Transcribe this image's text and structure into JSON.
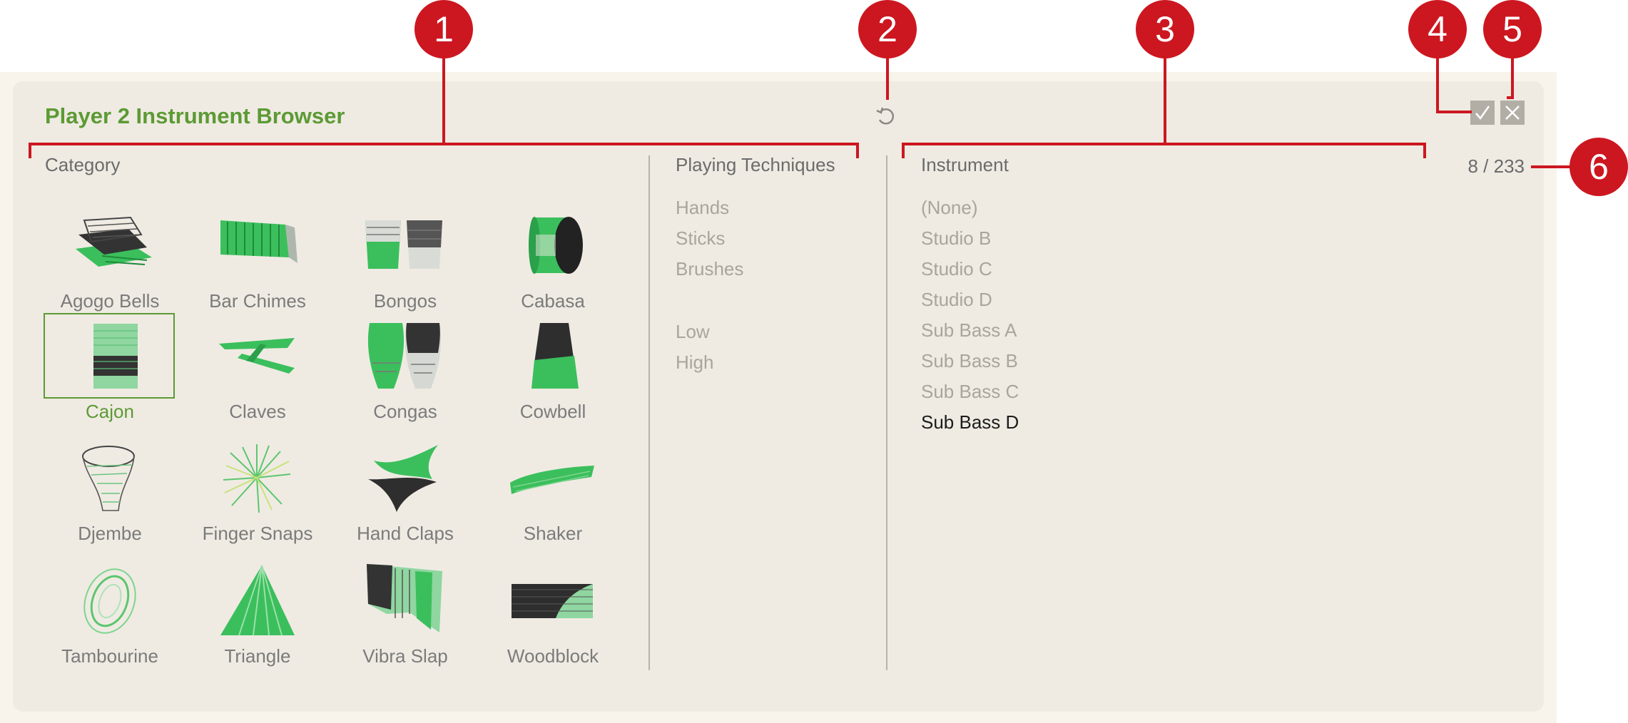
{
  "browser": {
    "title": "Player 2 Instrument Browser",
    "counter": "8 / 233",
    "category_label": "Category",
    "techniques_label": "Playing Techniques",
    "instrument_label": "Instrument"
  },
  "categories": [
    {
      "label": "Agogo Bells",
      "icon": "agogo-bells-icon"
    },
    {
      "label": "Bar Chimes",
      "icon": "bar-chimes-icon"
    },
    {
      "label": "Bongos",
      "icon": "bongos-icon"
    },
    {
      "label": "Cabasa",
      "icon": "cabasa-icon"
    },
    {
      "label": "Cajon",
      "icon": "cajon-icon",
      "selected": true
    },
    {
      "label": "Claves",
      "icon": "claves-icon"
    },
    {
      "label": "Congas",
      "icon": "congas-icon"
    },
    {
      "label": "Cowbell",
      "icon": "cowbell-icon"
    },
    {
      "label": "Djembe",
      "icon": "djembe-icon"
    },
    {
      "label": "Finger Snaps",
      "icon": "finger-snaps-icon"
    },
    {
      "label": "Hand Claps",
      "icon": "hand-claps-icon"
    },
    {
      "label": "Shaker",
      "icon": "shaker-icon"
    },
    {
      "label": "Tambourine",
      "icon": "tambourine-icon"
    },
    {
      "label": "Triangle",
      "icon": "triangle-icon"
    },
    {
      "label": "Vibra Slap",
      "icon": "vibra-slap-icon"
    },
    {
      "label": "Woodblock",
      "icon": "woodblock-icon"
    }
  ],
  "techniques": [
    "Hands",
    "Sticks",
    "Brushes",
    "Low",
    "High"
  ],
  "instruments": [
    "(None)",
    "Studio B",
    "Studio C",
    "Studio D",
    "Sub Bass A",
    "Sub Bass B",
    "Sub Bass C",
    "Sub Bass D"
  ],
  "selected_instrument": "Sub Bass D",
  "callouts": [
    "1",
    "2",
    "3",
    "4",
    "5",
    "6"
  ],
  "colors": {
    "accent_green": "#5d9a34",
    "callout_red": "#cc1720",
    "panel_bg": "#efebe3",
    "selected_text": "#1c1c1c",
    "muted_text": "#a9a59d"
  }
}
